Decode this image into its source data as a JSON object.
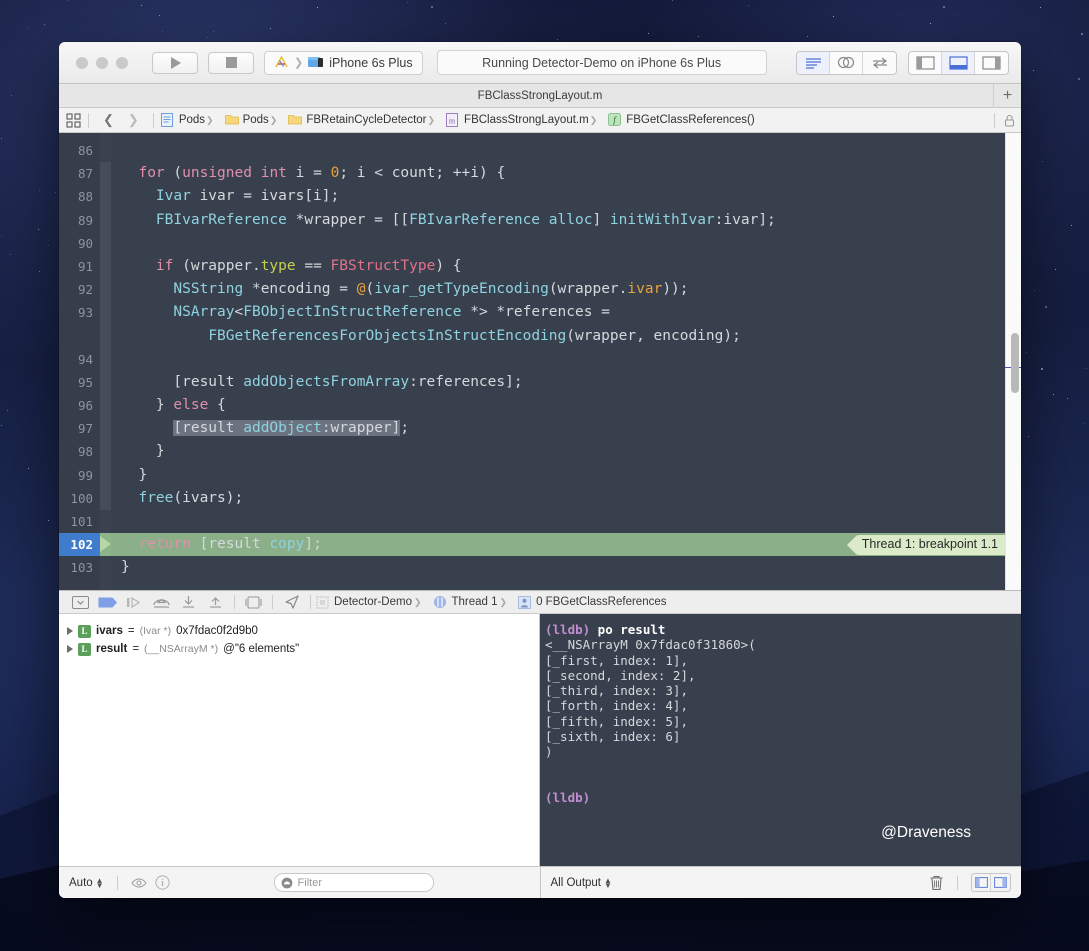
{
  "window": {
    "title": "FBClassStrongLayout.m"
  },
  "toolbar": {
    "run_label": "run-button",
    "stop_label": "stop-button",
    "scheme": "iPhone 6s Plus",
    "status": "Running Detector-Demo on iPhone 6s Plus",
    "editor_segments": [
      "standard-editor",
      "assistant-editor",
      "version-editor"
    ],
    "view_segments": [
      "navigator-toggle",
      "debug-area-toggle",
      "utilities-toggle"
    ],
    "tab_plus": "+"
  },
  "jumpbar": {
    "crumbs": [
      {
        "icon": "project-icon",
        "label": "Pods"
      },
      {
        "icon": "folder-icon",
        "label": "Pods"
      },
      {
        "icon": "folder-icon",
        "label": "FBRetainCycleDetector"
      },
      {
        "icon": "m-file-icon",
        "label": "FBClassStrongLayout.m"
      },
      {
        "icon": "function-icon",
        "label": "FBGetClassReferences()"
      }
    ]
  },
  "editor": {
    "first_line": 86,
    "current_line": 102,
    "breakpoint_badge": "Thread 1: breakpoint 1.1",
    "lines": [
      {
        "n": 86,
        "tokens": []
      },
      {
        "n": 87,
        "tokens": [
          {
            "t": "  ",
            "c": "plain"
          },
          {
            "t": "for",
            "c": "kw"
          },
          {
            "t": " (",
            "c": "plain"
          },
          {
            "t": "unsigned",
            "c": "kw"
          },
          {
            "t": " ",
            "c": "plain"
          },
          {
            "t": "int",
            "c": "kw"
          },
          {
            "t": " i = ",
            "c": "plain"
          },
          {
            "t": "0",
            "c": "num"
          },
          {
            "t": "; i < count; ++i) {",
            "c": "plain"
          }
        ]
      },
      {
        "n": 88,
        "tokens": [
          {
            "t": "    ",
            "c": "plain"
          },
          {
            "t": "Ivar",
            "c": "ty"
          },
          {
            "t": " ivar = ivars[i];",
            "c": "plain"
          }
        ]
      },
      {
        "n": 89,
        "tokens": [
          {
            "t": "    ",
            "c": "plain"
          },
          {
            "t": "FBIvarReference",
            "c": "ty"
          },
          {
            "t": " *wrapper = [[",
            "c": "plain"
          },
          {
            "t": "FBIvarReference",
            "c": "ty"
          },
          {
            "t": " ",
            "c": "plain"
          },
          {
            "t": "alloc",
            "c": "ty"
          },
          {
            "t": "] ",
            "c": "plain"
          },
          {
            "t": "initWithIvar",
            "c": "ty"
          },
          {
            "t": ":ivar];",
            "c": "plain"
          }
        ]
      },
      {
        "n": 90,
        "tokens": []
      },
      {
        "n": 91,
        "tokens": [
          {
            "t": "    ",
            "c": "plain"
          },
          {
            "t": "if",
            "c": "kw"
          },
          {
            "t": " (wrapper.",
            "c": "plain"
          },
          {
            "t": "type",
            "c": "prop"
          },
          {
            "t": " == ",
            "c": "plain"
          },
          {
            "t": "FBStructType",
            "c": "const"
          },
          {
            "t": ") {",
            "c": "plain"
          }
        ]
      },
      {
        "n": 92,
        "tokens": [
          {
            "t": "      ",
            "c": "plain"
          },
          {
            "t": "NSString",
            "c": "ty"
          },
          {
            "t": " *encoding = ",
            "c": "plain"
          },
          {
            "t": "@",
            "c": "orange"
          },
          {
            "t": "(",
            "c": "plain"
          },
          {
            "t": "ivar_getTypeEncoding",
            "c": "ty"
          },
          {
            "t": "(wrapper.",
            "c": "plain"
          },
          {
            "t": "ivar",
            "c": "orange"
          },
          {
            "t": "));",
            "c": "plain"
          }
        ]
      },
      {
        "n": 93,
        "tokens": [
          {
            "t": "      ",
            "c": "plain"
          },
          {
            "t": "NSArray",
            "c": "ty"
          },
          {
            "t": "<",
            "c": "plain"
          },
          {
            "t": "FBObjectInStructReference",
            "c": "ty"
          },
          {
            "t": " *> *references =",
            "c": "plain"
          }
        ]
      },
      {
        "n": null,
        "tokens": [
          {
            "t": "          ",
            "c": "plain"
          },
          {
            "t": "FBGetReferencesForObjectsInStructEncoding",
            "c": "ty"
          },
          {
            "t": "(wrapper, encoding);",
            "c": "plain"
          }
        ]
      },
      {
        "n": 94,
        "tokens": []
      },
      {
        "n": 95,
        "tokens": [
          {
            "t": "      [result ",
            "c": "plain"
          },
          {
            "t": "addObjectsFromArray",
            "c": "ty"
          },
          {
            "t": ":references];",
            "c": "plain"
          }
        ]
      },
      {
        "n": 96,
        "tokens": [
          {
            "t": "    } ",
            "c": "plain"
          },
          {
            "t": "else",
            "c": "kw"
          },
          {
            "t": " {",
            "c": "plain"
          }
        ]
      },
      {
        "n": 97,
        "tokens": [
          {
            "t": "      ",
            "c": "plain"
          },
          {
            "t": "[result ",
            "c": "plain sel"
          },
          {
            "t": "addObject",
            "c": "ty sel"
          },
          {
            "t": ":wrapper]",
            "c": "plain sel"
          },
          {
            "t": ";",
            "c": "plain"
          }
        ]
      },
      {
        "n": 98,
        "tokens": [
          {
            "t": "    }",
            "c": "plain"
          }
        ]
      },
      {
        "n": 99,
        "tokens": [
          {
            "t": "  }",
            "c": "plain"
          }
        ]
      },
      {
        "n": 100,
        "tokens": [
          {
            "t": "  ",
            "c": "plain"
          },
          {
            "t": "free",
            "c": "ty"
          },
          {
            "t": "(ivars);",
            "c": "plain"
          }
        ]
      },
      {
        "n": 101,
        "tokens": []
      },
      {
        "n": 102,
        "tokens": [
          {
            "t": "  ",
            "c": "plain"
          },
          {
            "t": "return",
            "c": "kw"
          },
          {
            "t": " [result ",
            "c": "plain"
          },
          {
            "t": "copy",
            "c": "ty"
          },
          {
            "t": "];",
            "c": "plain"
          }
        ]
      },
      {
        "n": 103,
        "tokens": [
          {
            "t": "}",
            "c": "plain"
          }
        ]
      }
    ]
  },
  "debugbar": {
    "buttons": [
      "hide-debug-area",
      "breakpoints-toggle",
      "continue",
      "step-over",
      "step-into",
      "step-out",
      "view-hierarchy",
      "location-simulate"
    ],
    "crumbs": [
      {
        "icon": "process-icon",
        "label": "Detector-Demo"
      },
      {
        "icon": "thread-icon",
        "label": "Thread 1"
      },
      {
        "icon": "frame-icon",
        "label": "0 FBGetClassReferences"
      }
    ]
  },
  "variables": [
    {
      "badge": "L",
      "name": "ivars",
      "type": "(Ivar *)",
      "value": "0x7fdac0f2d9b0"
    },
    {
      "badge": "L",
      "name": "result",
      "type": "(__NSArrayM *)",
      "value": "@\"6 elements\""
    }
  ],
  "console": {
    "lines": [
      {
        "prompt": "(lldb)",
        "cmd": " po result"
      },
      {
        "text": "<__NSArrayM 0x7fdac0f31860>("
      },
      {
        "text": "[_first, index: 1],"
      },
      {
        "text": "[_second, index: 2],"
      },
      {
        "text": "[_third, index: 3],"
      },
      {
        "text": "[_forth, index: 4],"
      },
      {
        "text": "[_fifth, index: 5],"
      },
      {
        "text": "[_sixth, index: 6]"
      },
      {
        "text": ")"
      },
      {
        "text": ""
      },
      {
        "text": ""
      },
      {
        "prompt": "(lldb)",
        "cmd": ""
      }
    ],
    "watermark": "@Draveness"
  },
  "bottombar": {
    "scope_label": "Auto",
    "filter_placeholder": "Filter",
    "output_label": "All Output",
    "trash_icon": "trash-icon"
  }
}
